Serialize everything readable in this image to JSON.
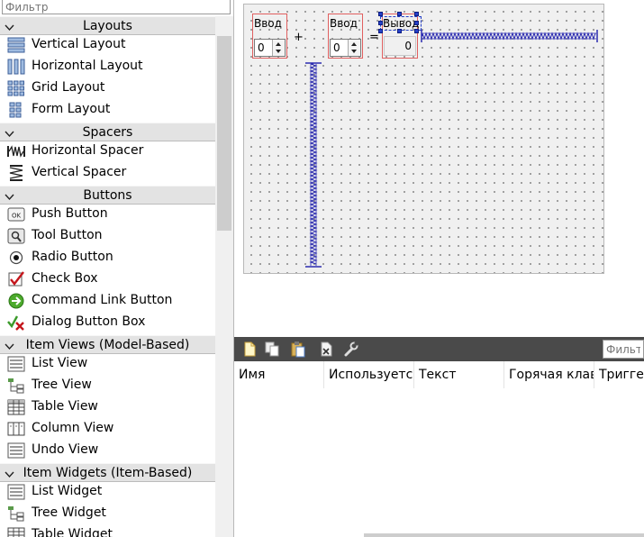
{
  "widget_box": {
    "filter_placeholder": "Фильтр",
    "categories": [
      {
        "label": "Layouts",
        "items": [
          "Vertical Layout",
          "Horizontal Layout",
          "Grid Layout",
          "Form Layout"
        ]
      },
      {
        "label": "Spacers",
        "items": [
          "Horizontal Spacer",
          "Vertical Spacer"
        ]
      },
      {
        "label": "Buttons",
        "items": [
          "Push Button",
          "Tool Button",
          "Radio Button",
          "Check Box",
          "Command Link Button",
          "Dialog Button Box"
        ]
      },
      {
        "label": "Item Views (Model-Based)",
        "items": [
          "List View",
          "Tree View",
          "Table View",
          "Column View",
          "Undo View"
        ]
      },
      {
        "label": "Item Widgets (Item-Based)",
        "items": [
          "List Widget",
          "Tree Widget",
          "Table Widget"
        ]
      }
    ],
    "icons": {
      "Vertical Layout": "vertical-layout-icon",
      "Horizontal Layout": "horizontal-layout-icon",
      "Grid Layout": "grid-layout-icon",
      "Form Layout": "form-layout-icon",
      "Horizontal Spacer": "horizontal-spacer-icon",
      "Vertical Spacer": "vertical-spacer-icon",
      "Push Button": "push-button-icon",
      "Tool Button": "tool-button-icon",
      "Radio Button": "radio-button-icon",
      "Check Box": "check-box-icon",
      "Command Link Button": "command-link-icon",
      "Dialog Button Box": "dialog-button-box-icon",
      "List View": "list-view-icon",
      "Tree View": "tree-view-icon",
      "Table View": "table-view-icon",
      "Column View": "column-view-icon",
      "Undo View": "undo-view-icon",
      "List Widget": "list-widget-icon",
      "Tree Widget": "tree-widget-icon",
      "Table Widget": "table-widget-icon"
    }
  },
  "form": {
    "input1_label": "Ввод",
    "input1_value": "0",
    "plus_sign": "+",
    "input2_label": "Ввод",
    "input2_value": "0",
    "equals_sign": "=",
    "output_label": "Вывод",
    "output_value": "0"
  },
  "action_editor": {
    "toolbar_icons": [
      "new-action-icon",
      "copy-action-icon",
      "paste-action-icon",
      "delete-action-icon",
      "configure-icon"
    ],
    "filter_placeholder": "Фильтр",
    "columns": [
      "Имя",
      "Используется",
      "Текст",
      "Горячая клавиша",
      "Триггер"
    ]
  },
  "colors": {
    "selection_handle": "#2540c8",
    "layout_box_border": "#e06060",
    "spacer": "#2a2ab0",
    "toolbar_bg": "#4a4a4a"
  }
}
